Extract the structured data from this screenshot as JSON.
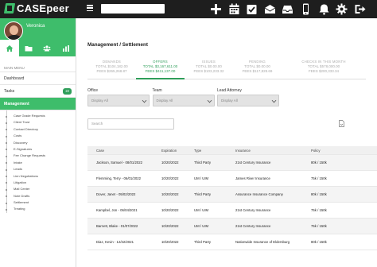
{
  "app": {
    "brand": "CASEpeer"
  },
  "header": {
    "icons": [
      "plus-icon",
      "calendar-icon",
      "checkbox-icon",
      "inbox-icon",
      "tray-icon",
      "phone-icon",
      "bell-icon",
      "gear-icon",
      "logout-icon"
    ]
  },
  "user": {
    "name": "Veronica"
  },
  "sidebar": {
    "main_menu_label": "MAIN MENU",
    "items": [
      {
        "label": "Dashboard"
      },
      {
        "label": "Tasks",
        "badge": "22"
      },
      {
        "label": "Management"
      }
    ],
    "subitems": [
      "Case Grade Requests",
      "Client Trust",
      "Contact Directory",
      "Costs",
      "Discovery",
      "E-Signatures",
      "Fee Change Requests",
      "Intake",
      "Leads",
      "Lien Negotiations",
      "Litigation",
      "Mail Center",
      "Note Drafts",
      "Settlement",
      "Treating"
    ]
  },
  "page": {
    "title": "Management / Settlement"
  },
  "stats": [
    {
      "label": "DEMANDS",
      "total": "TOTAL $104,182.00",
      "fees": "FEES $265,268.87"
    },
    {
      "label": "OFFERS",
      "total": "TOTAL $3,167,611.00",
      "fees": "FEES $411,137.00"
    },
    {
      "label": "ISSUES",
      "total": "TOTAL $0.00.00",
      "fees": "FEES $103,233.32"
    },
    {
      "label": "PENDING",
      "total": "TOTAL $0.00.00",
      "fees": "FEES $117,828.69"
    },
    {
      "label": "CHECKS IN THIS MONTH",
      "total": "TOTAL $578,000.00",
      "fees": "FEES $200,333.34"
    }
  ],
  "filters": [
    {
      "label": "Office",
      "value": "Display All"
    },
    {
      "label": "Team",
      "value": "Display All"
    },
    {
      "label": "Lead Attorney",
      "value": "Display All"
    }
  ],
  "search": {
    "placeholder": "Search"
  },
  "table": {
    "columns": [
      "Case",
      "Expiration",
      "Type",
      "Insurance",
      "Policy"
    ],
    "rows": [
      [
        "Jackson, Samuel - 08/01/2022",
        "10/20/2022",
        "Third Party",
        "21st Century Insurance",
        "80k / 150k"
      ],
      [
        "Flemming, Terry - 06/01/2022",
        "10/20/2022",
        "UM / UIM",
        "James River Insurance",
        "75k / 150k"
      ],
      [
        "Dover, Janet - 05/02/2022",
        "10/20/2022",
        "Third Party",
        "Assurance Insurance Company",
        "80k / 150k"
      ],
      [
        "Kampbel, Jon - 06/04/2021",
        "10/20/2022",
        "UM / UIM",
        "21st Century Insurance",
        "75k / 150k"
      ],
      [
        "Barnett, Blake - 01/07/2022",
        "10/20/2022",
        "UM / UIM",
        "21st Century Insurance",
        "75k / 150k"
      ],
      [
        "Diaz, Kevin - 12/22/2021",
        "10/20/2022",
        "Third Party",
        "Nationwide Insurance of Eldersburg",
        "80k / 150k"
      ]
    ]
  },
  "colors": {
    "brand_green": "#3ebd6b",
    "dark_header": "#1e1e1e",
    "active_green": "#2f9e5a"
  }
}
